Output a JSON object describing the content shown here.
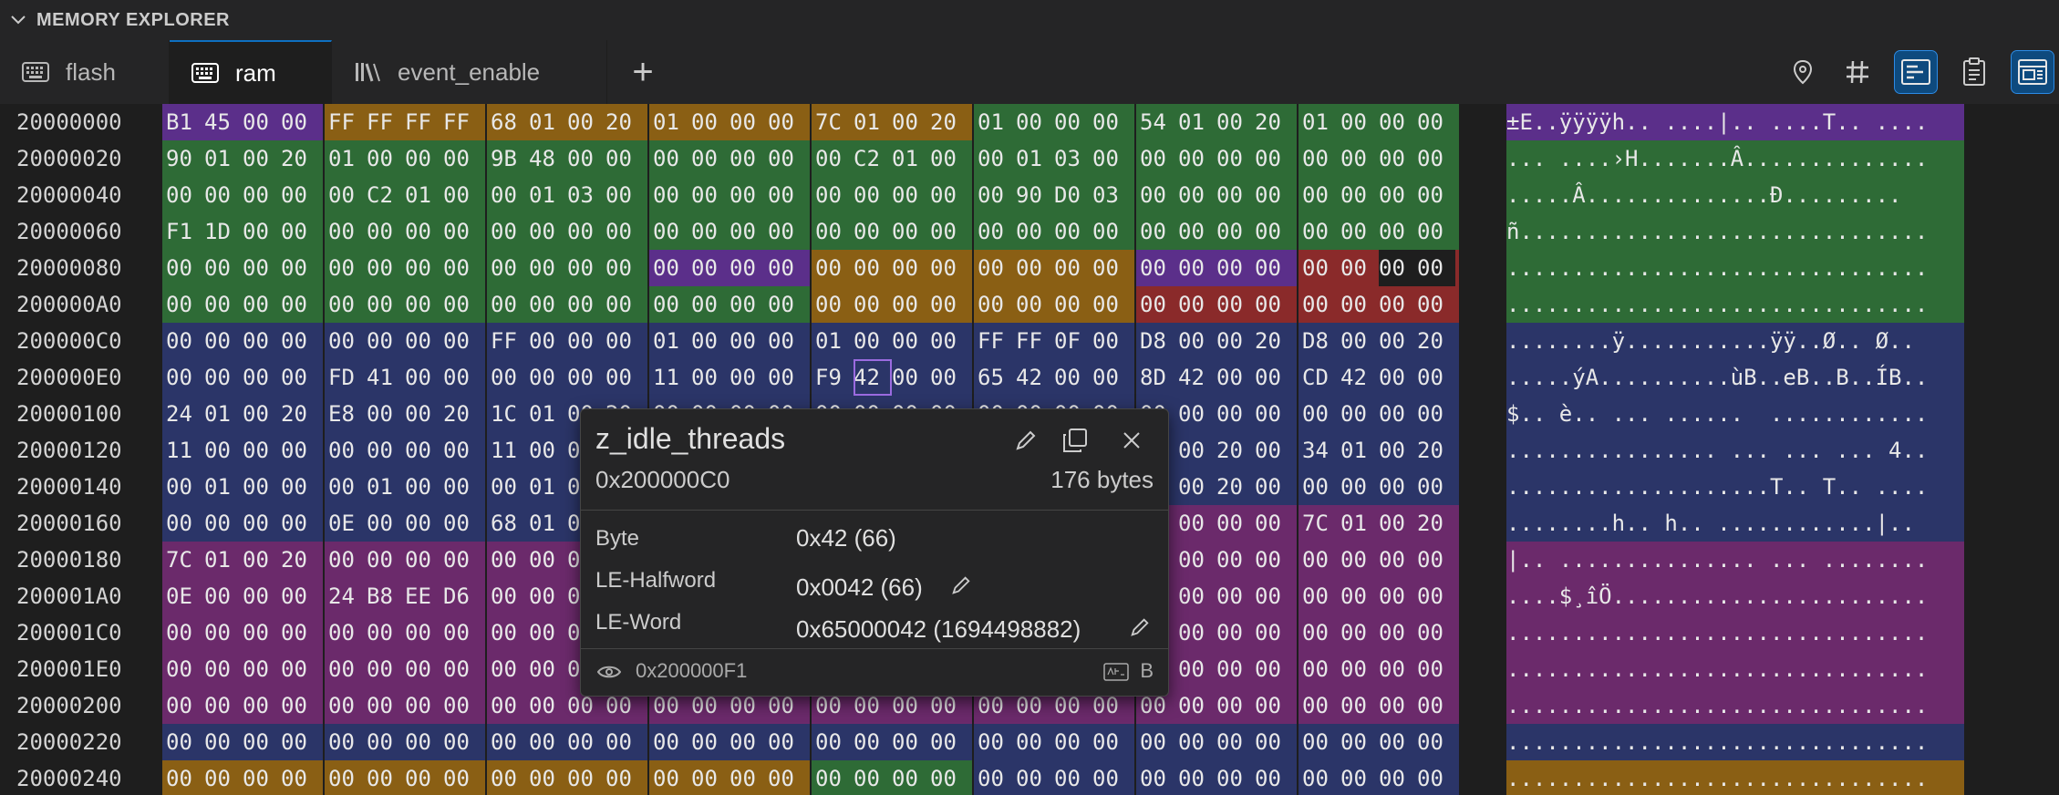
{
  "panel": {
    "title": "MEMORY EXPLORER"
  },
  "tabs": [
    {
      "label": "flash",
      "active": false,
      "icon": "keyboard-icon"
    },
    {
      "label": "ram",
      "active": true,
      "icon": "keyboard-icon"
    },
    {
      "label": "event_enable",
      "active": false,
      "icon": "library-icon"
    }
  ],
  "add_tab_label": "+",
  "toolbar": [
    "location-pin-icon",
    "hash-icon",
    "layout-lines-icon",
    "clipboard-icon",
    "memory-view-icon"
  ],
  "colors": {
    "purple": "#5b2f8a",
    "orange": "#8a5f14",
    "green": "#2e6b36",
    "blue": "#2b3568",
    "magenta": "#6b2a6b",
    "red": "#8a2a2a",
    "accent": "#0e70c0"
  },
  "rows": [
    {
      "addr": "20000000",
      "words": [
        "B1 45 00 00",
        "FF FF FF FF",
        "68 01 00 20",
        "01 00 00 00",
        "7C 01 00 20",
        "01 00 00 00",
        "54 01 00 20",
        "01 00 00 00"
      ],
      "colors": [
        "purple",
        "orange",
        "orange",
        "orange",
        "orange",
        "green",
        "green",
        "green"
      ],
      "ascii": "±E..ÿÿÿÿh.. ....|.. ....T.. ...."
    },
    {
      "addr": "20000020",
      "words": [
        "90 01 00 20",
        "01 00 00 00",
        "9B 48 00 00",
        "00 00 00 00",
        "00 C2 01 00",
        "00 01 03 00",
        "00 00 00 00",
        "00 00 00 00"
      ],
      "colors": [
        "green",
        "green",
        "green",
        "green",
        "green",
        "green",
        "green",
        "green"
      ],
      "ascii": "... ....›H.......Â.............."
    },
    {
      "addr": "20000040",
      "words": [
        "00 00 00 00",
        "00 C2 01 00",
        "00 01 03 00",
        "00 00 00 00",
        "00 00 00 00",
        "00 90 D0 03",
        "00 00 00 00",
        "00 00 00 00"
      ],
      "colors": [
        "green",
        "green",
        "green",
        "green",
        "green",
        "green",
        "green",
        "green"
      ],
      "ascii": ".....Â..............Ð........."
    },
    {
      "addr": "20000060",
      "words": [
        "F1 1D 00 00",
        "00 00 00 00",
        "00 00 00 00",
        "00 00 00 00",
        "00 00 00 00",
        "00 00 00 00",
        "00 00 00 00",
        "00 00 00 00"
      ],
      "colors": [
        "green",
        "green",
        "green",
        "green",
        "green",
        "green",
        "green",
        "green"
      ],
      "ascii": "ñ..............................."
    },
    {
      "addr": "20000080",
      "words": [
        "00 00 00 00",
        "00 00 00 00",
        "00 00 00 00",
        "00 00 00 00",
        "00 00 00 00",
        "00 00 00 00",
        "00 00 00 00",
        "00 00 00 00"
      ],
      "colors": [
        "green",
        "green",
        "green",
        "purple",
        "orange",
        "orange",
        "purple",
        "red"
      ],
      "ascii": "................................"
    },
    {
      "addr": "200000A0",
      "words": [
        "00 00 00 00",
        "00 00 00 00",
        "00 00 00 00",
        "00 00 00 00",
        "00 00 00 00",
        "00 00 00 00",
        "00 00 00 00",
        "00 00 00 00"
      ],
      "colors": [
        "green",
        "green",
        "green",
        "green",
        "orange",
        "orange",
        "red",
        "red"
      ],
      "ascii": "................................"
    },
    {
      "addr": "200000C0",
      "words": [
        "00 00 00 00",
        "00 00 00 00",
        "FF 00 00 00",
        "01 00 00 00",
        "01 00 00 00",
        "FF FF 0F 00",
        "D8 00 00 20",
        "D8 00 00 20"
      ],
      "colors": [
        "blue",
        "blue",
        "blue",
        "blue",
        "blue",
        "blue",
        "blue",
        "blue"
      ],
      "ascii": "........ÿ...........ÿÿ..Ø.. Ø.."
    },
    {
      "addr": "200000E0",
      "words": [
        "00 00 00 00",
        "FD 41 00 00",
        "00 00 00 00",
        "11 00 00 00",
        "F9 42 00 00",
        "65 42 00 00",
        "8D 42 00 00",
        "CD 42 00 00"
      ],
      "colors": [
        "blue",
        "blue",
        "blue",
        "blue",
        "blue",
        "blue",
        "blue",
        "blue"
      ],
      "ascii": ".....ýA..........ùB..eB..B..ÍB.."
    },
    {
      "addr": "20000100",
      "words": [
        "24 01 00 20",
        "E8 00 00 20",
        "1C 01 00 20",
        "00 00 00 00",
        "00 00 00 00",
        "00 00 00 00",
        "00 00 00 00",
        "00 00 00 00"
      ],
      "colors": [
        "blue",
        "blue",
        "blue",
        "blue",
        "blue",
        "blue",
        "blue",
        "blue"
      ],
      "ascii": "$.. è.. ... ......  ............"
    },
    {
      "addr": "20000120",
      "words": [
        "11 00 00 00",
        "00 00 00 00",
        "11 00 00 00",
        "00 00 00 00",
        "00 00 00 00",
        "00 00 00 00",
        "01 00 20 00",
        "34 01 00 20"
      ],
      "colors": [
        "blue",
        "blue",
        "blue",
        "blue",
        "blue",
        "blue",
        "blue",
        "blue"
      ],
      "ascii": "................ ... ... ... 4.."
    },
    {
      "addr": "20000140",
      "words": [
        "00 01 00 00",
        "00 01 00 00",
        "00 01 00 00",
        "00 00 00 00",
        "00 00 00 00",
        "00 00 00 00",
        "01 00 20 00",
        "00 00 00 00"
      ],
      "colors": [
        "blue",
        "blue",
        "blue",
        "blue",
        "blue",
        "blue",
        "blue",
        "blue"
      ],
      "ascii": "....................T.. T.. ...."
    },
    {
      "addr": "20000160",
      "words": [
        "00 00 00 00",
        "0E 00 00 00",
        "68 01 00 20",
        "00 00 00 00",
        "00 00 00 00",
        "00 00 00 00",
        "00 00 00 00",
        "7C 01 00 20"
      ],
      "colors": [
        "blue",
        "blue",
        "blue",
        "blue",
        "blue",
        "blue",
        "magenta",
        "magenta"
      ],
      "ascii": "........h.. h.. ............|.."
    },
    {
      "addr": "20000180",
      "words": [
        "7C 01 00 20",
        "00 00 00 00",
        "00 00 00 00",
        "00 00 00 00",
        "00 00 00 00",
        "00 00 00 00",
        "00 00 00 00",
        "00 00 00 00"
      ],
      "colors": [
        "magenta",
        "magenta",
        "magenta",
        "magenta",
        "magenta",
        "magenta",
        "magenta",
        "magenta"
      ],
      "ascii": "|.. ............... ... ........"
    },
    {
      "addr": "200001A0",
      "words": [
        "0E 00 00 00",
        "24 B8 EE D6",
        "00 00 00 00",
        "00 00 00 00",
        "00 00 00 00",
        "00 00 00 00",
        "00 00 00 00",
        "00 00 00 00"
      ],
      "colors": [
        "magenta",
        "magenta",
        "magenta",
        "magenta",
        "magenta",
        "magenta",
        "magenta",
        "magenta"
      ],
      "ascii": "....$¸îÖ........................"
    },
    {
      "addr": "200001C0",
      "words": [
        "00 00 00 00",
        "00 00 00 00",
        "00 00 00 00",
        "00 00 00 00",
        "00 00 00 00",
        "00 00 00 00",
        "00 00 00 00",
        "00 00 00 00"
      ],
      "colors": [
        "magenta",
        "magenta",
        "magenta",
        "magenta",
        "magenta",
        "magenta",
        "magenta",
        "magenta"
      ],
      "ascii": "................................"
    },
    {
      "addr": "200001E0",
      "words": [
        "00 00 00 00",
        "00 00 00 00",
        "00 00 00 00",
        "00 00 00 00",
        "00 00 00 00",
        "00 00 00 00",
        "00 00 00 00",
        "00 00 00 00"
      ],
      "colors": [
        "magenta",
        "magenta",
        "magenta",
        "magenta",
        "magenta",
        "magenta",
        "magenta",
        "magenta"
      ],
      "ascii": "................................"
    },
    {
      "addr": "20000200",
      "words": [
        "00 00 00 00",
        "00 00 00 00",
        "00 00 00 00",
        "00 00 00 00",
        "00 00 00 00",
        "00 00 00 00",
        "00 00 00 00",
        "00 00 00 00"
      ],
      "colors": [
        "magenta",
        "magenta",
        "magenta",
        "magenta",
        "magenta",
        "magenta",
        "magenta",
        "magenta"
      ],
      "ascii": "................................"
    },
    {
      "addr": "20000220",
      "words": [
        "00 00 00 00",
        "00 00 00 00",
        "00 00 00 00",
        "00 00 00 00",
        "00 00 00 00",
        "00 00 00 00",
        "00 00 00 00",
        "00 00 00 00"
      ],
      "colors": [
        "blue",
        "blue",
        "blue",
        "blue",
        "blue",
        "blue",
        "blue",
        "blue"
      ],
      "ascii": "................................"
    },
    {
      "addr": "20000240",
      "words": [
        "00 00 00 00",
        "00 00 00 00",
        "00 00 00 00",
        "00 00 00 00",
        "00 00 00 00",
        "00 00 00 00",
        "00 00 00 00",
        "00 00 00 00"
      ],
      "colors": [
        "orange",
        "orange",
        "orange",
        "orange",
        "green",
        "blue",
        "blue",
        "blue"
      ],
      "ascii": "................................"
    }
  ],
  "hover": {
    "title": "z_idle_threads",
    "address": "0x200000C0",
    "size": "176 bytes",
    "byte_label": "Byte",
    "byte_value": "0x42 (66)",
    "halfword_label": "LE-Halfword",
    "halfword_value": "0x0042 (66)",
    "word_label": "LE-Word",
    "word_value": "0x65000042 (1694498882)",
    "footer_address": "0x200000F1",
    "footer_badge": "B"
  }
}
